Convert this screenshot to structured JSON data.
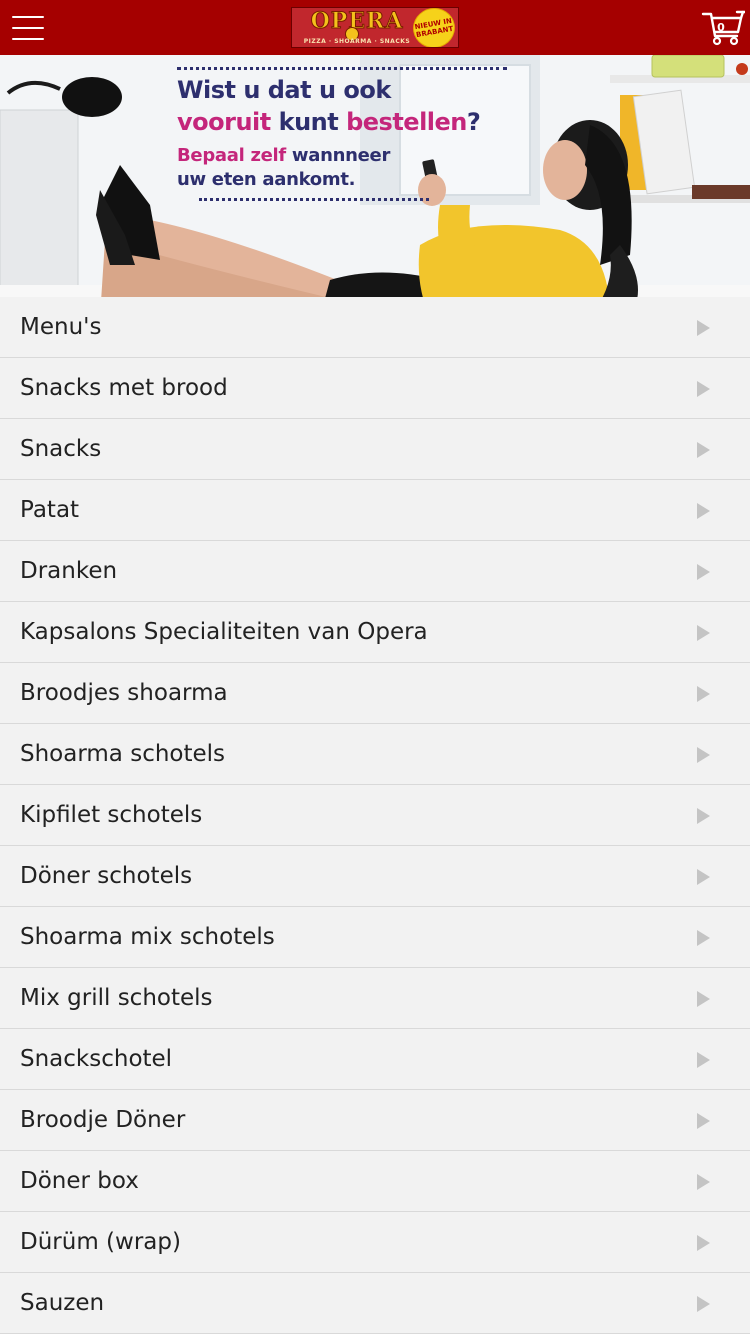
{
  "header": {
    "background_color": "#a50000",
    "menu_icon": "hamburger-icon",
    "logo": {
      "name": "OPERA",
      "tagline": "PIZZA · SHOARMA · SNACKS",
      "badge": "NIEUW IN BRABANT"
    },
    "cart": {
      "icon": "shopping-cart-icon",
      "count": "0"
    }
  },
  "banner": {
    "line1": "Wist u dat u ook",
    "line2_a": "vooruit",
    "line2_b": "kunt",
    "line2_c": "bestellen",
    "line2_d": "?",
    "line3_a": "Bepaal zelf",
    "line3_b": "wannneer",
    "line4": "uw eten aankomt.",
    "accent_color": "#c4267b",
    "text_color": "#2d2f6e"
  },
  "menu": {
    "arrow_icon": "chevron-right-icon",
    "items": [
      "Menu's",
      "Snacks met brood",
      "Snacks",
      "Patat",
      "Dranken",
      "Kapsalons Specialiteiten van Opera",
      "Broodjes shoarma",
      "Shoarma schotels",
      "Kipfilet schotels",
      "Döner schotels",
      "Shoarma mix schotels",
      "Mix grill schotels",
      "Snackschotel",
      "Broodje Döner",
      "Döner box",
      "Dürüm (wrap)",
      "Sauzen"
    ]
  }
}
